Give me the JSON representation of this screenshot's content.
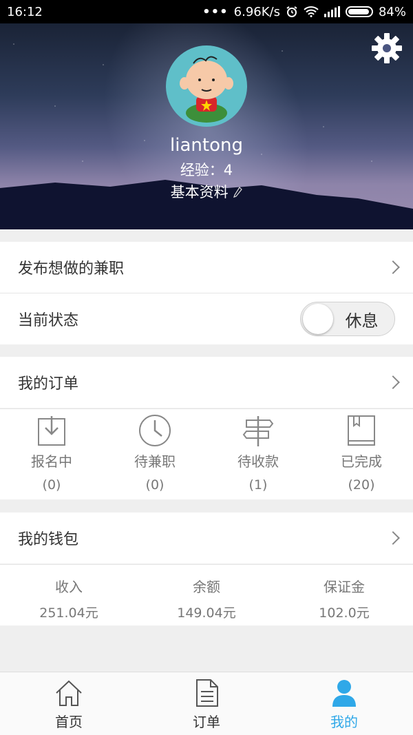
{
  "status_bar": {
    "time": "16:12",
    "net_speed": "6.96K/s",
    "battery": "84%"
  },
  "profile": {
    "username": "liantong",
    "experience": "经验：4",
    "edit_profile": "基本资料"
  },
  "menu": {
    "post_job": "发布想做的兼职",
    "status_label": "当前状态",
    "status_value": "休息",
    "my_orders": "我的订单",
    "my_wallet": "我的钱包"
  },
  "orders": [
    {
      "label": "报名中",
      "count": "(0)",
      "icon": "download-box-icon"
    },
    {
      "label": "待兼职",
      "count": "(0)",
      "icon": "clock-icon"
    },
    {
      "label": "待收款",
      "count": "(1)",
      "icon": "signpost-icon"
    },
    {
      "label": "已完成",
      "count": "(20)",
      "icon": "book-icon"
    }
  ],
  "wallet": [
    {
      "label": "收入",
      "value": "251.04元"
    },
    {
      "label": "余额",
      "value": "149.04元"
    },
    {
      "label": "保证金",
      "value": "102.0元"
    }
  ],
  "nav": [
    {
      "label": "首页",
      "icon": "home-icon"
    },
    {
      "label": "订单",
      "icon": "document-icon"
    },
    {
      "label": "我的",
      "icon": "user-icon"
    }
  ],
  "colors": {
    "accent": "#2fa8e8",
    "avatar_bg": "#5fbfc9"
  }
}
